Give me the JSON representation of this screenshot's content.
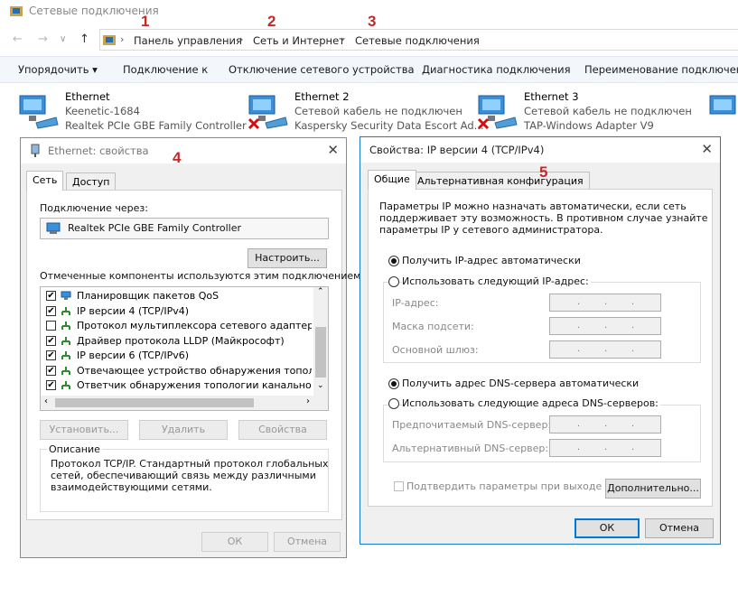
{
  "window": {
    "title": "Сетевые подключения"
  },
  "annotations": [
    "1",
    "2",
    "3",
    "4",
    "5"
  ],
  "breadcrumb": [
    "Панель управления",
    "Сеть и Интернет",
    "Сетевые подключения"
  ],
  "commands": [
    "Упорядочить ▾",
    "Подключение к",
    "Отключение сетевого устройства",
    "Диагностика подключения",
    "Переименование подключения"
  ],
  "connections": [
    {
      "name": "Ethernet",
      "line1": "Keenetic-1684",
      "line2": "Realtek PCIe GBE Family Controller"
    },
    {
      "name": "Ethernet 2",
      "line1": "Сетевой кабель не подключен",
      "line2": "Kaspersky Security Data Escort Ad..."
    },
    {
      "name": "Ethernet 3",
      "line1": "Сетевой кабель не подключен",
      "line2": "TAP-Windows Adapter V9"
    }
  ],
  "eth_dialog": {
    "title": "Ethernet: свойства",
    "tabs": [
      "Сеть",
      "Доступ"
    ],
    "connect_via_label": "Подключение через:",
    "adapter": "Realtek PCIe GBE Family Controller",
    "configure_button": "Настроить...",
    "components_label": "Отмеченные компоненты используются этим подключением:",
    "components": [
      {
        "label": "Планировщик пакетов QoS",
        "checked": true
      },
      {
        "label": "IP версии 4 (TCP/IPv4)",
        "checked": true
      },
      {
        "label": "Протокол мультиплексора сетевого адаптера (Ма",
        "checked": false
      },
      {
        "label": "Драйвер протокола LLDP (Майкрософт)",
        "checked": true
      },
      {
        "label": "IP версии 6 (TCP/IPv6)",
        "checked": true
      },
      {
        "label": "Отвечающее устройство обнаружения топологии к",
        "checked": true
      },
      {
        "label": "Ответчик обнаружения топологии канального уров",
        "checked": true
      }
    ],
    "install_button": "Установить...",
    "remove_button": "Удалить",
    "properties_button": "Свойства",
    "description_title": "Описание",
    "description_text": [
      "Протокол TCP/IP. Стандартный протокол глобальных",
      "сетей, обеспечивающий связь между различными",
      "взаимодействующими сетями."
    ],
    "ok_button": "ОК",
    "cancel_button": "Отмена"
  },
  "ipv4_dialog": {
    "title": "Свойства: IP версии 4 (TCP/IPv4)",
    "tabs": [
      "Общие",
      "Альтернативная конфигурация"
    ],
    "intro": [
      "Параметры IP можно назначать автоматически, если сеть",
      "поддерживает эту возможность. В противном случае узнайте",
      "параметры IP у сетевого администратора."
    ],
    "auto_ip_label": "Получить IP-адрес автоматически",
    "manual_ip_label": "Использовать следующий IP-адрес:",
    "ip_label": "IP-адрес:",
    "mask_label": "Маска подсети:",
    "gateway_label": "Основной шлюз:",
    "auto_dns_label": "Получить адрес DNS-сервера автоматически",
    "manual_dns_label": "Использовать следующие адреса DNS-серверов:",
    "pref_dns_label": "Предпочитаемый DNS-сервер:",
    "alt_dns_label": "Альтернативный DNS-сервер:",
    "validate_label": "Подтвердить параметры при выходе",
    "advanced_button": "Дополнительно...",
    "ok_button": "ОК",
    "cancel_button": "Отмена",
    "ip_mode": "auto",
    "dns_mode": "auto"
  }
}
